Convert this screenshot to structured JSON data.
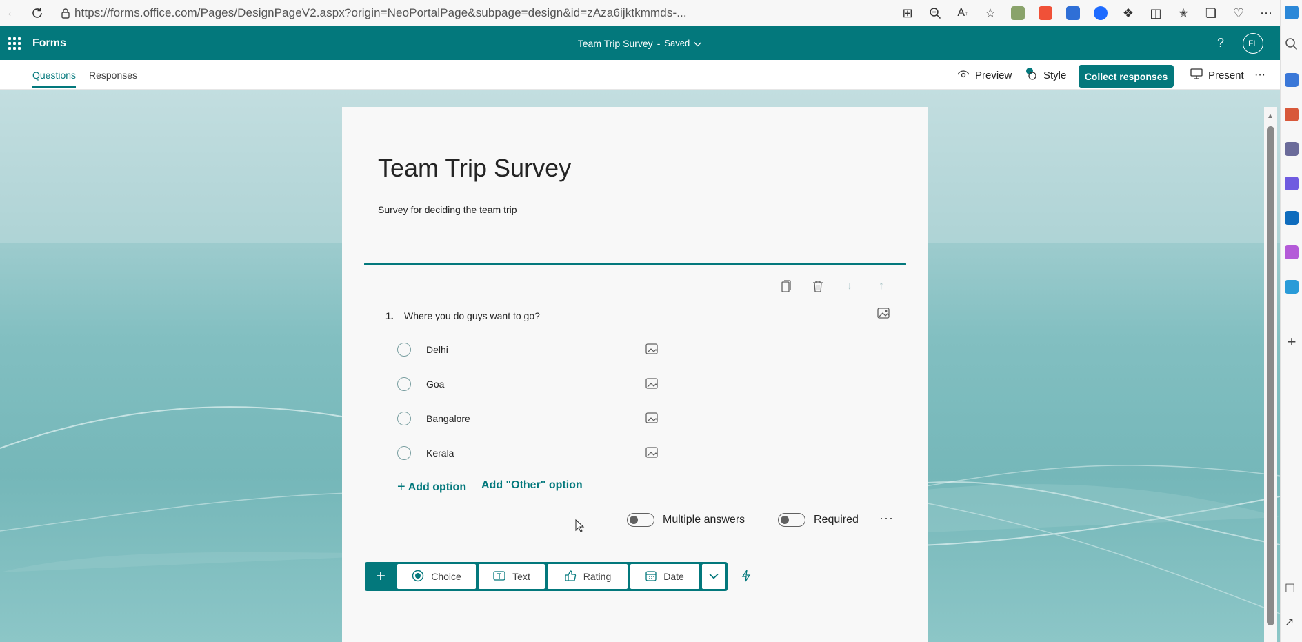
{
  "browser": {
    "url": "https://forms.office.com/Pages/DesignPageV2.aspx?origin=NeoPortalPage&subpage=design&id=zAza6ijktkmmds-..."
  },
  "header": {
    "app_name": "Forms",
    "form_title": "Team Trip Survey",
    "separator": "-",
    "saved_status": "Saved",
    "avatar_initials": "FL",
    "help": "?"
  },
  "toolbar": {
    "tabs": [
      "Questions",
      "Responses"
    ],
    "preview_label": "Preview",
    "style_label": "Style",
    "collect_label": "Collect responses",
    "present_label": "Present",
    "more": "···"
  },
  "form": {
    "title": "Team Trip Survey",
    "description": "Survey for deciding the team trip",
    "question": {
      "number": "1.",
      "text": "Where you do guys want to go?",
      "options": [
        "Delhi",
        "Goa",
        "Bangalore",
        "Kerala"
      ],
      "add_option_label": "Add option",
      "add_other_label": "Add \"Other\" option",
      "multiple_answers_label": "Multiple answers",
      "required_label": "Required",
      "more": "···"
    }
  },
  "add_bar": {
    "choice_label": "Choice",
    "text_label": "Text",
    "rating_label": "Rating",
    "date_label": "Date"
  },
  "colors": {
    "brand": "#03787c",
    "canvas_top": "#c6e0e2",
    "canvas_mid": "#75b7b9"
  }
}
